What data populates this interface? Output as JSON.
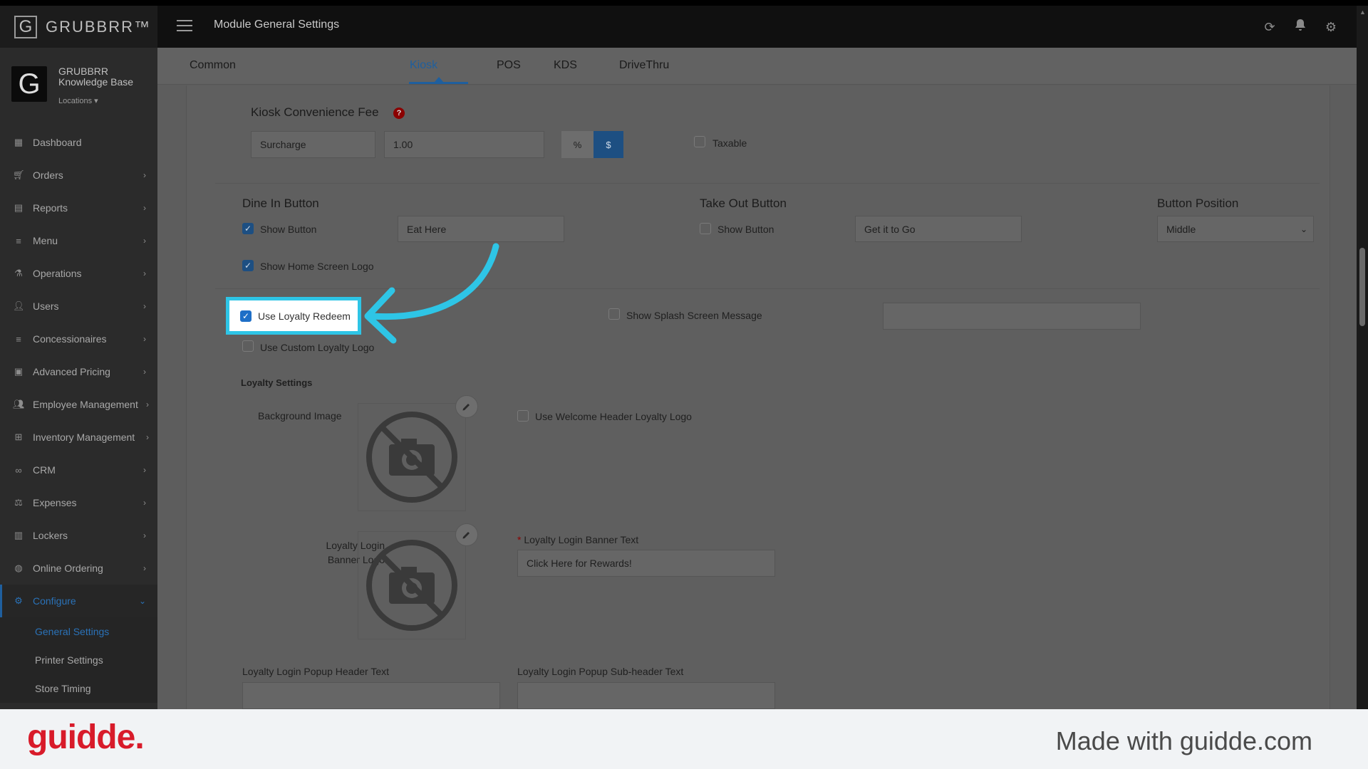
{
  "app": {
    "logo_letter": "G",
    "logo_name": "GRUBBRR™"
  },
  "header": {
    "page_title": "Module General Settings"
  },
  "brand": {
    "logo_letter": "G",
    "name_line1": "GRUBBRR",
    "name_line2": "Knowledge Base",
    "locations": "Locations ▾"
  },
  "sidebar": {
    "items": [
      {
        "label": "Dashboard",
        "icon": "dashboard-icon"
      },
      {
        "label": "Orders",
        "icon": "cart-icon"
      },
      {
        "label": "Reports",
        "icon": "report-icon"
      },
      {
        "label": "Menu",
        "icon": "menu-list-icon"
      },
      {
        "label": "Operations",
        "icon": "flask-icon"
      },
      {
        "label": "Users",
        "icon": "users-icon"
      },
      {
        "label": "Concessionaires",
        "icon": "list-icon"
      },
      {
        "label": "Advanced Pricing",
        "icon": "money-icon"
      },
      {
        "label": "Employee Management",
        "icon": "group-icon"
      },
      {
        "label": "Inventory Management",
        "icon": "sitemap-icon"
      },
      {
        "label": "CRM",
        "icon": "link-icon"
      },
      {
        "label": "Expenses",
        "icon": "scale-icon"
      },
      {
        "label": "Lockers",
        "icon": "lockers-icon"
      },
      {
        "label": "Online Ordering",
        "icon": "globe-icon"
      },
      {
        "label": "Configure",
        "icon": "cog-icon"
      }
    ],
    "sub_items": [
      {
        "label": "General Settings"
      },
      {
        "label": "Printer Settings"
      },
      {
        "label": "Store Timing"
      }
    ]
  },
  "tabs": [
    {
      "label": "Common"
    },
    {
      "label": "Kiosk"
    },
    {
      "label": "POS"
    },
    {
      "label": "KDS"
    },
    {
      "label": "DriveThru"
    }
  ],
  "fee": {
    "title": "Kiosk Convenience Fee",
    "name_value": "Surcharge",
    "amount_value": "1.00",
    "pct_label": "%",
    "dollar_label": "$",
    "taxable_label": "Taxable"
  },
  "dine_in": {
    "title": "Dine In Button",
    "show_button_label": "Show Button",
    "text_value": "Eat Here",
    "show_home_logo_label": "Show Home Screen Logo"
  },
  "take_out": {
    "title": "Take Out Button",
    "show_button_label": "Show Button",
    "text_value": "Get it to Go"
  },
  "button_position": {
    "title": "Button Position",
    "value": "Middle"
  },
  "loyalty": {
    "use_redeem_label": "Use Loyalty Redeem",
    "show_splash_label": "Show Splash Screen Message",
    "splash_value": "",
    "use_custom_logo_label": "Use Custom Loyalty Logo",
    "settings_title": "Loyalty Settings",
    "bg_image_label": "Background Image",
    "welcome_logo_label": "Use Welcome Header Loyalty Logo",
    "banner_logo_label_1": "Loyalty Login",
    "banner_logo_label_2": "Banner Logo",
    "banner_text_required": "*",
    "banner_text_label": "Loyalty Login Banner Text",
    "banner_text_value": "Click Here for Rewards!",
    "popup_header_label": "Loyalty Login Popup Header Text",
    "popup_subheader_label": "Loyalty Login Popup Sub-header Text",
    "popup_header_value": "",
    "popup_subheader_value": ""
  },
  "footer": {
    "brand": "guidde.",
    "made_with": "Made with guidde.com"
  },
  "colors": {
    "highlight": "#2ec5e6",
    "accent": "#1e6fc7",
    "footer_brand": "#d81b2a"
  }
}
